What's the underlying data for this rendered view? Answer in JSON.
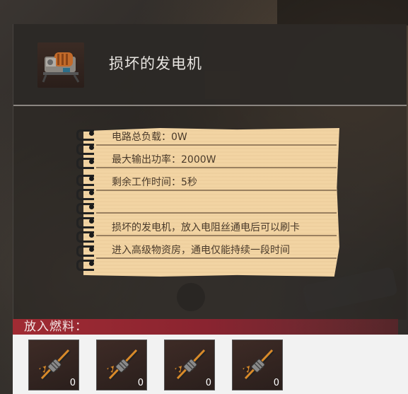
{
  "item": {
    "title": "损坏的发电机",
    "icon": "generator-icon"
  },
  "note": {
    "lines": [
      "电路总负载：0W",
      "最大输出功率：2000W",
      "剩余工作时间：5秒",
      "",
      "损坏的发电机，放入电阻丝通电后可以刷卡",
      "进入高级物资房，通电仅能持续一段时间"
    ]
  },
  "fuel": {
    "label": "放入燃料：",
    "slots": [
      {
        "icon": "resistance-wire-icon",
        "count": "0"
      },
      {
        "icon": "resistance-wire-icon",
        "count": "0"
      },
      {
        "icon": "resistance-wire-icon",
        "count": "0"
      },
      {
        "icon": "resistance-wire-icon",
        "count": "0"
      }
    ]
  },
  "colors": {
    "note_paper": "#f2d4a3",
    "fuel_bar": "#a02b33",
    "tray": "#f2f2f2"
  }
}
